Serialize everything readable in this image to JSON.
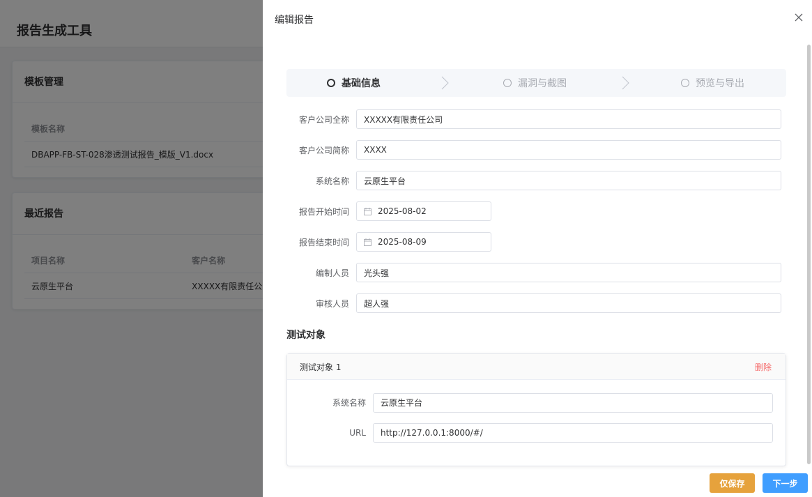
{
  "background": {
    "app_title": "报告生成工具",
    "template_card": {
      "title": "模板管理",
      "column_header": "模板名称",
      "rows": [
        "DBAPP-FB-ST-028渗透测试报告_模版_V1.docx"
      ]
    },
    "recent_card": {
      "title": "最近报告",
      "headers": [
        "项目名称",
        "客户名称"
      ],
      "rows": [
        [
          "云原生平台",
          "XXXXX有限责任公"
        ]
      ]
    }
  },
  "drawer": {
    "title": "编辑报告",
    "steps": [
      {
        "label": "基础信息",
        "active": true
      },
      {
        "label": "漏洞与截图",
        "active": false
      },
      {
        "label": "预览与导出",
        "active": false
      }
    ],
    "fields": {
      "company_full": {
        "label": "客户公司全称",
        "value": "XXXXX有限责任公司"
      },
      "company_short": {
        "label": "客户公司简称",
        "value": "XXXX"
      },
      "system_name": {
        "label": "系统名称",
        "value": "云原生平台"
      },
      "start_date": {
        "label": "报告开始时间",
        "value": "2025-08-02"
      },
      "end_date": {
        "label": "报告结束时间",
        "value": "2025-08-09"
      },
      "author": {
        "label": "编制人员",
        "value": "光头强"
      },
      "reviewer": {
        "label": "审核人员",
        "value": "超人强"
      }
    },
    "test_objects_title": "测试对象",
    "test_object": {
      "title": "测试对象 1",
      "delete_label": "删除",
      "system_name": {
        "label": "系统名称",
        "value": "云原生平台"
      },
      "url": {
        "label": "URL",
        "value": "http://127.0.0.1:8000/#/"
      }
    },
    "buttons": {
      "save_only": "仅保存",
      "next": "下一步"
    }
  },
  "colors": {
    "save_button": "#e6a23c",
    "next_button": "#409eff",
    "delete_link": "#f56c6c"
  }
}
